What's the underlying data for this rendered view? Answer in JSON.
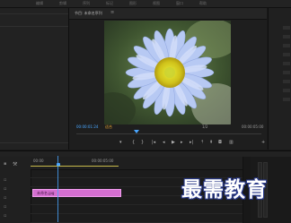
{
  "menu": {
    "items": [
      "编辑",
      "剪辑",
      "序列",
      "标记",
      "图形",
      "视图",
      "窗口",
      "帮助"
    ]
  },
  "program_monitor": {
    "title": "节目: 未命名序列",
    "timecode_current": "00:00:01:24",
    "fit": "适合",
    "quality": "1/2",
    "timecode_duration": "00:00:05:00",
    "transport_icons": [
      "marker-icon",
      "in-point-icon",
      "out-point-icon",
      "go-to-in-icon",
      "step-back-icon",
      "play-icon",
      "step-forward-icon",
      "go-to-out-icon",
      "lift-icon",
      "extract-icon",
      "export-frame-icon",
      "compare-icon",
      "add-icon"
    ]
  },
  "timeline": {
    "start_time": "00:00",
    "end_time": "00:00:05:00",
    "clip_label": "未命名.jpg",
    "clip_color": "#d46fd0",
    "playhead_color": "#4aa6ff"
  },
  "colors": {
    "accent": "#4aa6ff",
    "fit_label": "#e0a030",
    "workarea": "#c7b94a"
  },
  "watermark": "最需教育"
}
